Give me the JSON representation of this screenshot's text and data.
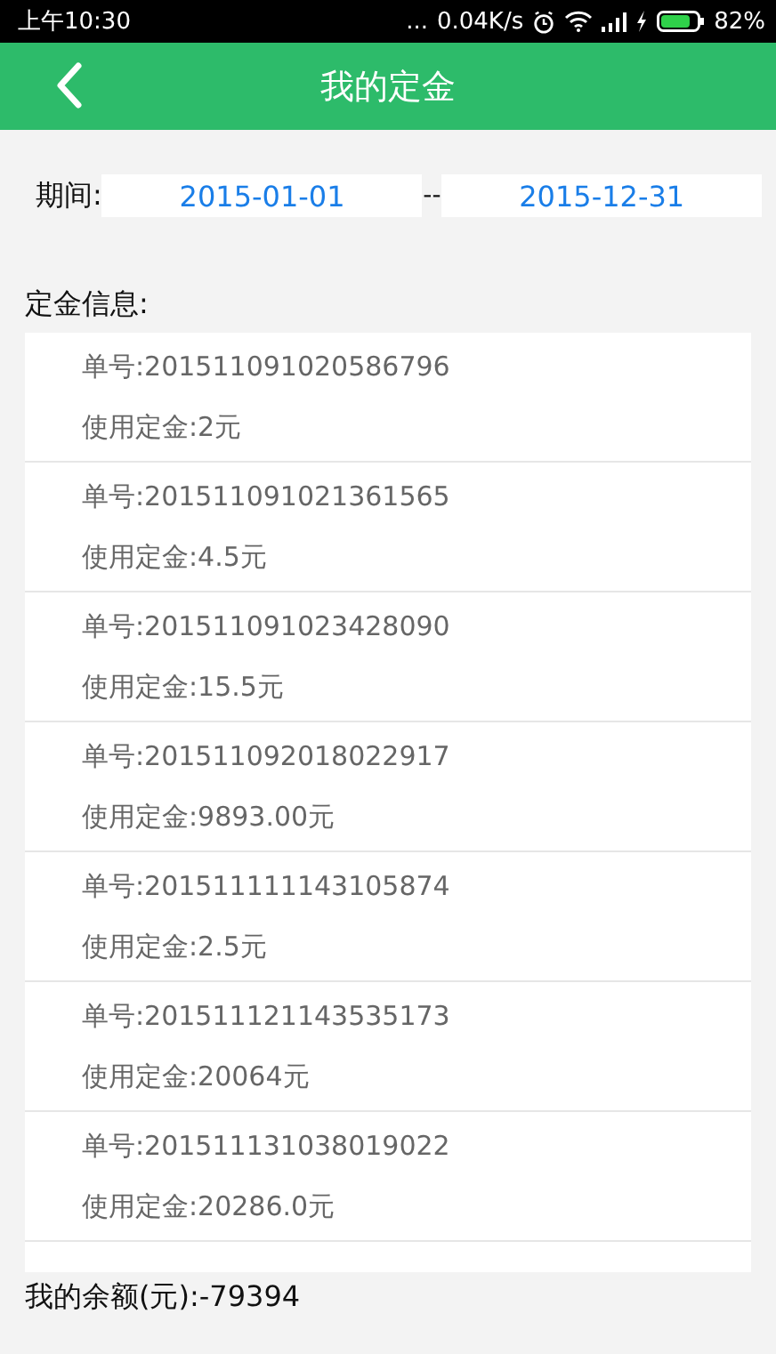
{
  "status_bar": {
    "time": "上午10:30",
    "dots": "...",
    "speed": "0.04K/s",
    "battery": "82%"
  },
  "header": {
    "title": "我的定金"
  },
  "period": {
    "label": "期间:",
    "start": "2015-01-01",
    "separator": "--",
    "end": "2015-12-31"
  },
  "section_title": "定金信息:",
  "deposits": [
    {
      "order": "单号:201511091020586796",
      "amount": "使用定金:2元"
    },
    {
      "order": "单号:201511091021361565",
      "amount": "使用定金:4.5元"
    },
    {
      "order": "单号:201511091023428090",
      "amount": "使用定金:15.5元"
    },
    {
      "order": "单号:201511092018022917",
      "amount": "使用定金:9893.00元"
    },
    {
      "order": "单号:201511111143105874",
      "amount": "使用定金:2.5元"
    },
    {
      "order": "单号:201511121143535173",
      "amount": "使用定金:20064元"
    },
    {
      "order": "单号:201511131038019022",
      "amount": "使用定金:20286.0元"
    }
  ],
  "balance": "我的余额(元):-79394"
}
